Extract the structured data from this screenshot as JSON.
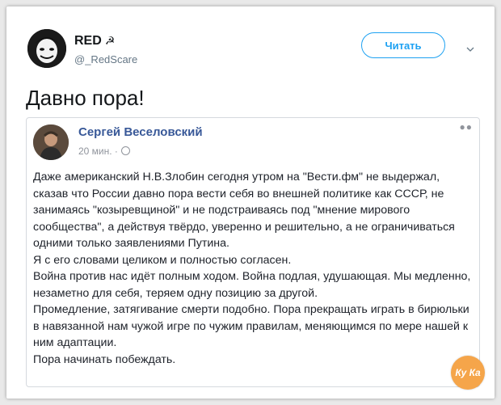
{
  "tweet": {
    "author_name": "RED",
    "author_flag": "☭",
    "author_handle": "@_RedScare",
    "follow_label": "Читать",
    "text": "Давно пора!"
  },
  "quote": {
    "author_name": "Сергей Веселовский",
    "time": "20 мин. ·",
    "paragraphs": [
      "Даже американский Н.В.Злобин сегодня утром на \"Вести.фм\" не выдержал, сказав что России давно пора вести себя во внешней политике как СССР, не занимаясь \"козыревщиной\" и не подстраиваясь под \"мнение мирового сообщества\", а действуя твёрдо, уверенно и решительно, а не ограничиваться одними только заявлениями Путина.",
      "Я с его словами целиком и полностью согласен.",
      "Война против нас идёт полным ходом. Война подлая, удушающая. Мы медленно, незаметно для себя, теряем одну позицию за другой.",
      "Промедление, затягивание смерти подобно. Пора прекращать играть в бирюльки в навязанной нам чужой игре по чужим правилам, меняющимся по мере нашей к ним адаптации.",
      "Пора начинать побеждать."
    ]
  },
  "watermark": "Ку Ка"
}
